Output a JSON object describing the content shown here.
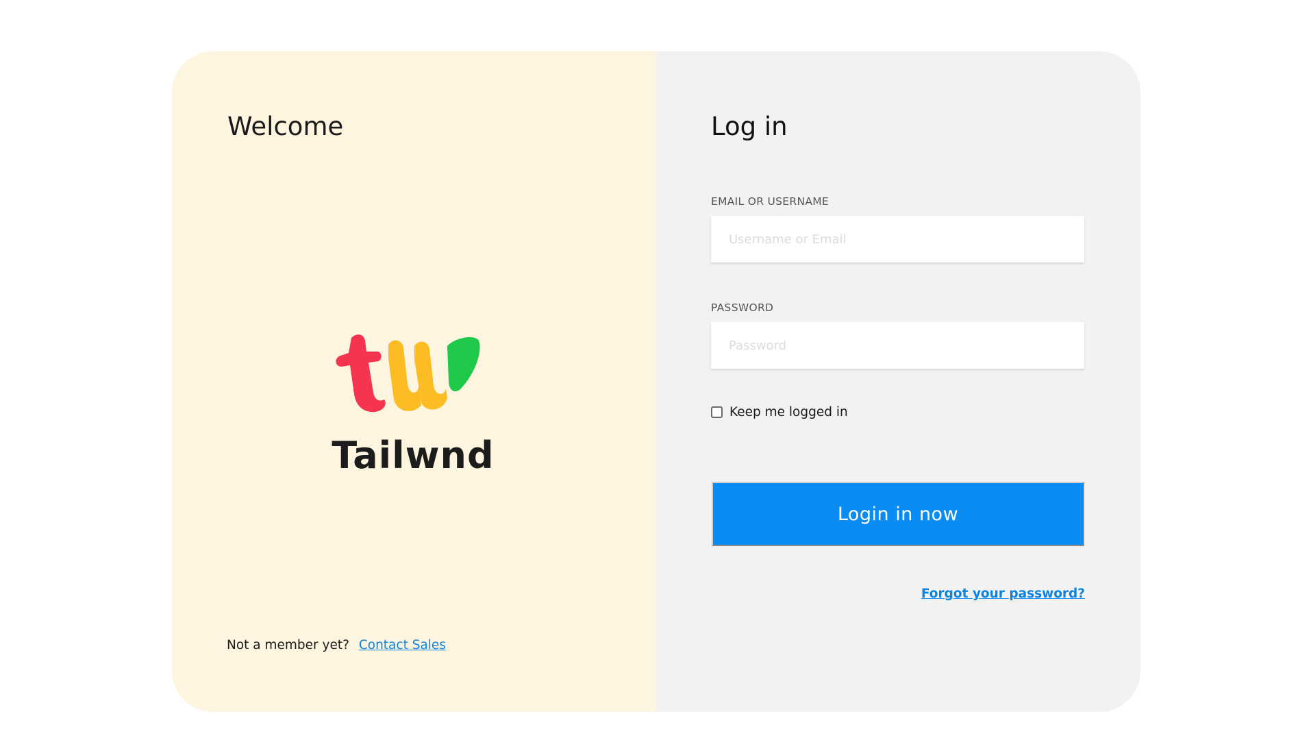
{
  "welcome": {
    "title": "Welcome",
    "brand_name": "Tailwnd",
    "member_text": "Not a member yet?",
    "contact_link": "Contact Sales"
  },
  "login": {
    "title": "Log in",
    "email_label": "EMAIL OR USERNAME",
    "email_placeholder": "Username or Email",
    "email_value": "",
    "password_label": "PASSWORD",
    "password_placeholder": "Password",
    "password_value": "",
    "remember_label": "Keep me logged in",
    "remember_checked": false,
    "submit_label": "Login in now",
    "forgot_link": "Forgot your password?"
  },
  "colors": {
    "left_panel_bg": "#fdf5df",
    "right_panel_bg": "#f2f2f2",
    "accent": "#0a8cf5",
    "link": "#0a84e0",
    "logo_red": "#f5344f",
    "logo_yellow": "#fcbd24",
    "logo_green": "#1ec94a"
  },
  "icons": {
    "logo": "tailwnd-logo-icon",
    "checkbox": "checkbox-unchecked-icon"
  }
}
